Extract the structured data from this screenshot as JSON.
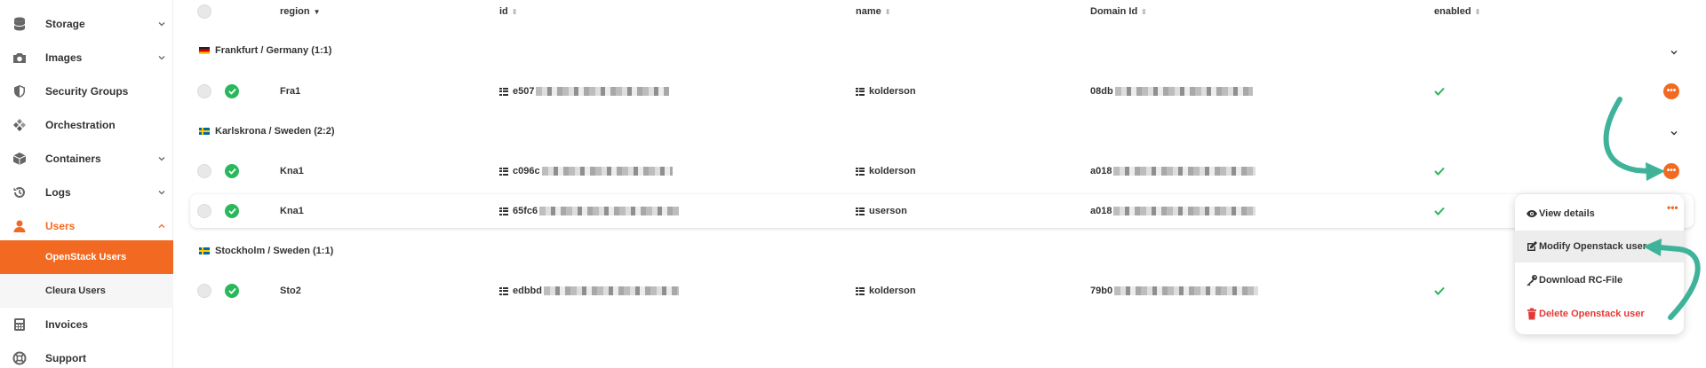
{
  "sidebar": {
    "items": [
      {
        "label": "Storage",
        "icon": "database-icon",
        "chevron": "down"
      },
      {
        "label": "Images",
        "icon": "camera-icon",
        "chevron": "down"
      },
      {
        "label": "Security Groups",
        "icon": "shield-icon",
        "chevron": ""
      },
      {
        "label": "Orchestration",
        "icon": "orchestration-icon",
        "chevron": ""
      },
      {
        "label": "Containers",
        "icon": "box-icon",
        "chevron": "down"
      },
      {
        "label": "Logs",
        "icon": "history-icon",
        "chevron": "down"
      },
      {
        "label": "Users",
        "icon": "user-icon",
        "chevron": "up",
        "active": true
      },
      {
        "label": "Invoices",
        "icon": "calculator-icon",
        "chevron": ""
      },
      {
        "label": "Support",
        "icon": "lifebuoy-icon",
        "chevron": ""
      }
    ],
    "sub_items": [
      {
        "label": "OpenStack Users",
        "selected": true
      },
      {
        "label": "Cleura Users",
        "selected": false
      }
    ]
  },
  "table": {
    "columns": {
      "region": "region",
      "id": "id",
      "name": "name",
      "domain_id": "Domain Id",
      "enabled": "enabled"
    },
    "groups": [
      {
        "label": "Frankfurt / Germany (1:1)",
        "flag": "de",
        "rows": [
          {
            "region": "Fra1",
            "id": "e507",
            "name": "kolderson",
            "domain_id": "08db",
            "enabled": true
          }
        ]
      },
      {
        "label": "Karlskrona / Sweden (2:2)",
        "flag": "se",
        "rows": [
          {
            "region": "Kna1",
            "id": "c096c",
            "name": "kolderson",
            "domain_id": "a018",
            "enabled": true
          },
          {
            "region": "Kna1",
            "id": "65fc6",
            "name": "userson",
            "domain_id": "a018",
            "enabled": true
          }
        ]
      },
      {
        "label": "Stockholm / Sweden (1:1)",
        "flag": "se",
        "rows": [
          {
            "region": "Sto2",
            "id": "edbbd",
            "name": "kolderson",
            "domain_id": "79b0",
            "enabled": true
          }
        ]
      }
    ]
  },
  "context_menu": {
    "items": [
      {
        "label": "View details",
        "icon": "eye-icon"
      },
      {
        "label": "Modify Openstack user",
        "icon": "edit-icon"
      },
      {
        "label": "Download RC-File",
        "icon": "download-key-icon"
      },
      {
        "label": "Delete Openstack user",
        "icon": "trash-icon"
      }
    ]
  },
  "colors": {
    "accent": "#f26a21",
    "success": "#2bb75b",
    "danger": "#e53935",
    "annotation_arrow": "#3fb39a"
  }
}
